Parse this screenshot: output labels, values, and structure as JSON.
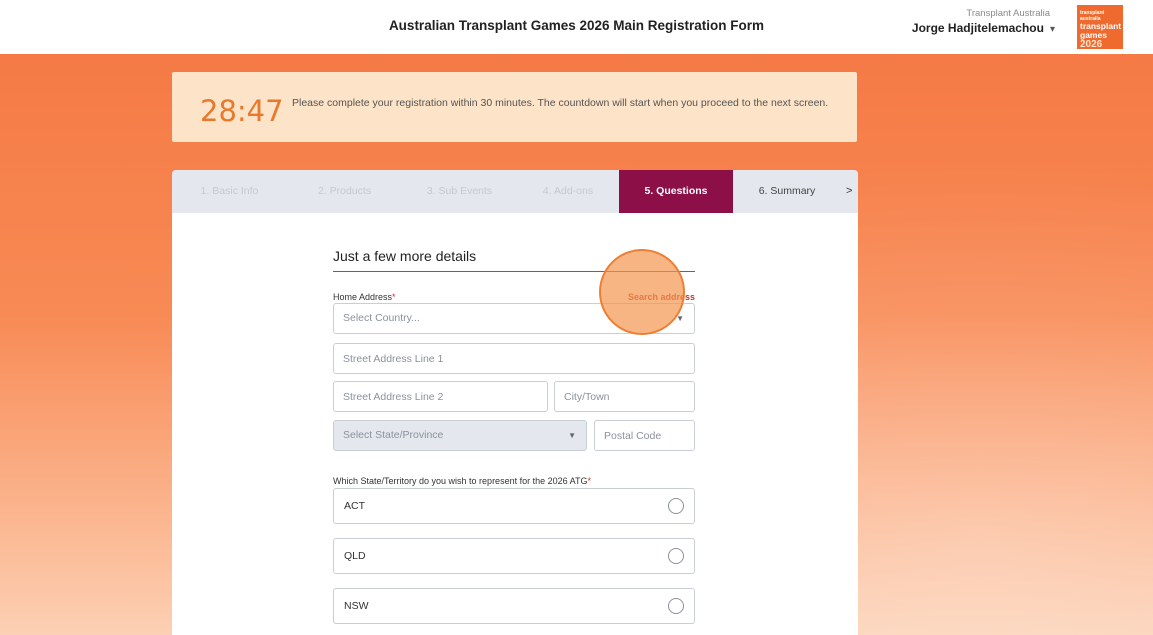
{
  "header": {
    "title": "Australian Transplant Games 2026 Main Registration Form",
    "org": "Transplant Australia",
    "user": "Jorge Hadjitelemachou",
    "logo": {
      "top": "transplant australia",
      "line1": "transplant",
      "line2": "games",
      "year": "2026"
    }
  },
  "timer": {
    "countdown": "28:47",
    "message": "Please complete your registration within 30 minutes. The countdown will start when you proceed to the next screen."
  },
  "tabs": [
    {
      "label": "1. Basic Info",
      "state": "done"
    },
    {
      "label": "2. Products",
      "state": "done"
    },
    {
      "label": "3. Sub Events",
      "state": "done"
    },
    {
      "label": "4. Add-ons",
      "state": "done"
    },
    {
      "label": "5. Questions",
      "state": "active"
    },
    {
      "label": "6. Summary",
      "state": "next"
    }
  ],
  "tab_scroll": ">",
  "form": {
    "section_title": "Just a few more details",
    "home_address_label": "Home Address",
    "required_marker": "*",
    "search_address_link": "Search address",
    "country_placeholder": "Select Country...",
    "street1_placeholder": "Street Address Line 1",
    "street2_placeholder": "Street Address Line 2",
    "city_placeholder": "City/Town",
    "state_placeholder": "Select State/Province",
    "postal_placeholder": "Postal Code",
    "state_question": "Which State/Territory do you wish to represent for the 2026 ATG",
    "state_options": [
      "ACT",
      "QLD",
      "NSW"
    ]
  },
  "colors": {
    "accent": "#8c1047",
    "orange": "#f57a45",
    "timer_bg": "#fde3c7",
    "timer_text": "#e8792c",
    "link": "#c0392b"
  }
}
